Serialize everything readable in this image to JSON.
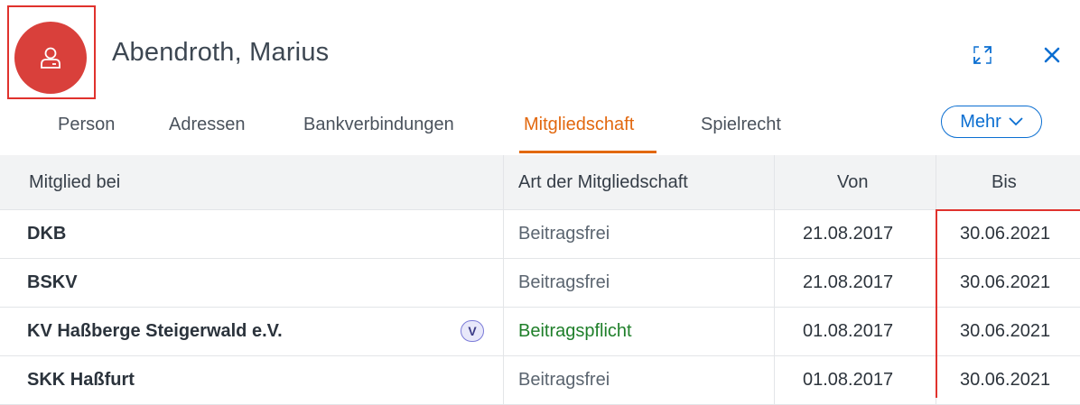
{
  "header": {
    "title": "Abendroth, Marius",
    "avatar_icon": "person-icon",
    "expand_icon": "expand-icon",
    "close_icon": "close-icon"
  },
  "tabs": [
    {
      "label": "Person",
      "active": false
    },
    {
      "label": "Adressen",
      "active": false
    },
    {
      "label": "Bankverbindungen",
      "active": false
    },
    {
      "label": "Mitgliedschaft",
      "active": true
    },
    {
      "label": "Spielrecht",
      "active": false
    }
  ],
  "more_button": {
    "label": "Mehr"
  },
  "table": {
    "columns": [
      "Mitglied bei",
      "Art der Mitgliedschaft",
      "Von",
      "Bis"
    ],
    "rows": [
      {
        "name": "DKB",
        "badge": "",
        "art": "Beitragsfrei",
        "von": "21.08.2017",
        "bis": "30.06.2021"
      },
      {
        "name": "BSKV",
        "badge": "",
        "art": "Beitragsfrei",
        "von": "21.08.2017",
        "bis": "30.06.2021"
      },
      {
        "name": "KV Haßberge Steigerwald e.V.",
        "badge": "V",
        "art": "Beitragspflicht",
        "von": "01.08.2017",
        "bis": "30.06.2021"
      },
      {
        "name": "SKK Haßfurt",
        "badge": "",
        "art": "Beitragsfrei",
        "von": "01.08.2017",
        "bis": "30.06.2021"
      }
    ]
  },
  "colors": {
    "accent": "#e2680f",
    "avatar": "#d9403b",
    "link": "#0a6ed1",
    "highlight": "#e0322d",
    "positive": "#1f7f2a"
  }
}
